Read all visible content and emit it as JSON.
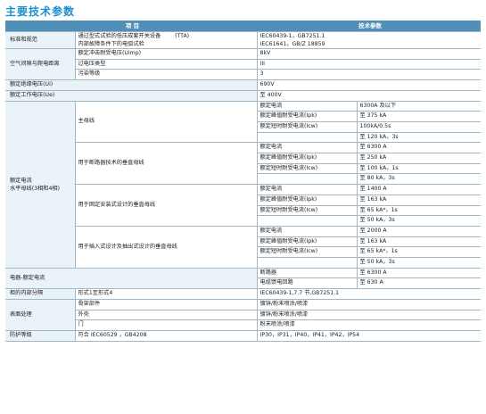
{
  "page": {
    "title": "主要技术参数",
    "header": [
      "项 目",
      "技术参数"
    ]
  },
  "rows": {
    "standards": {
      "label": "标准和规范",
      "desc1": "通过型式试验的低压成套开关设备",
      "desc1b": "(TTA)",
      "desc2": "内部故障条件下的电弧试验",
      "val1": "IEC60439-1，GB7251.1",
      "val2": "IEC61641，GB/Z 18859"
    },
    "clearance": {
      "label": "空气间隙与爬电距离",
      "items": [
        {
          "name": "额定冲击耐受电压(Uimp)",
          "value": "8kV"
        },
        {
          "name": "过电压类型",
          "value": "III"
        },
        {
          "name": "污染等级",
          "value": "3"
        }
      ]
    },
    "insulation": {
      "label": "额定绝缘电压(Ui)",
      "value": "690V"
    },
    "operating": {
      "label": "额定工作电压(Ue)",
      "value": "至 400V"
    },
    "busbar": {
      "label": "额定电流",
      "label2": "水平母线(3相和4相)",
      "main": {
        "name": "主母线",
        "items": [
          {
            "name": "额定电流",
            "value": "6300A 及以下"
          },
          {
            "name": "额定峰值耐受电流(Ipk)",
            "value": "至  375  kA"
          },
          {
            "name": "额定短时耐受电流(Icw)",
            "value": "100kA/0.5s"
          },
          {
            "name": "",
            "value": "至  120  kA，3s"
          }
        ]
      },
      "breaker": {
        "name": "用于断路器技术的垂直母线",
        "items": [
          {
            "name": "额定电流",
            "value": "至  6300  A"
          },
          {
            "name": "额定峰值耐受电流(Ipk)",
            "value": "至  250  kA"
          },
          {
            "name": "额定短时耐受电流(Icw)",
            "value": "至  100  kA，1s"
          },
          {
            "name": "",
            "value": "至  80  kA，3s"
          }
        ]
      },
      "fixed": {
        "name": "用于固定安装式设计的垂直母线",
        "items": [
          {
            "name": "额定电流",
            "value": "至  1400  A"
          },
          {
            "name": "额定峰值耐受电流(Ipk)",
            "value": "至  163  kA"
          },
          {
            "name": "额定短时耐受电流(Icw)",
            "value": "至  65  kA*，1s"
          },
          {
            "name": "",
            "value": "至  50  kA，3s"
          }
        ]
      },
      "plugin": {
        "name": "用于插入式设计及抽出式设计的垂直母线",
        "items": [
          {
            "name": "额定电流",
            "value": "至  2000  A"
          },
          {
            "name": "额定峰值耐受电流(Ipk)",
            "value": "至  163  kA"
          },
          {
            "name": "额定短时耐受电流(Icw)",
            "value": "至  65  kA*，1s"
          },
          {
            "name": "",
            "value": "至  50  kA，3s"
          }
        ]
      }
    },
    "equipment": {
      "label": "电器-额定电流",
      "items": [
        {
          "name": "断路器",
          "value": "至  6300  A"
        },
        {
          "name": "电缆馈电回路",
          "value": "至  630  A"
        }
      ]
    },
    "separation": {
      "label": "柜的内部分隔",
      "desc": "形式1至形式4",
      "value": "IEC60439-1,7.7 节,GB7251.1"
    },
    "surface": {
      "label": "表面处理",
      "items": [
        {
          "name": "骨架部件",
          "value": "镀锌/粉末喷涂/喷漆"
        },
        {
          "name": "外壳",
          "value": "镀锌/粉末喷涂/喷漆"
        },
        {
          "name": "门",
          "value": "粉末喷涂/喷漆"
        }
      ]
    },
    "protection": {
      "label": "防护等级",
      "desc": "符合 IEC60529 ，GB4208",
      "value": "IP30，IP31，IP40，IP41，IP42，IP54"
    }
  }
}
